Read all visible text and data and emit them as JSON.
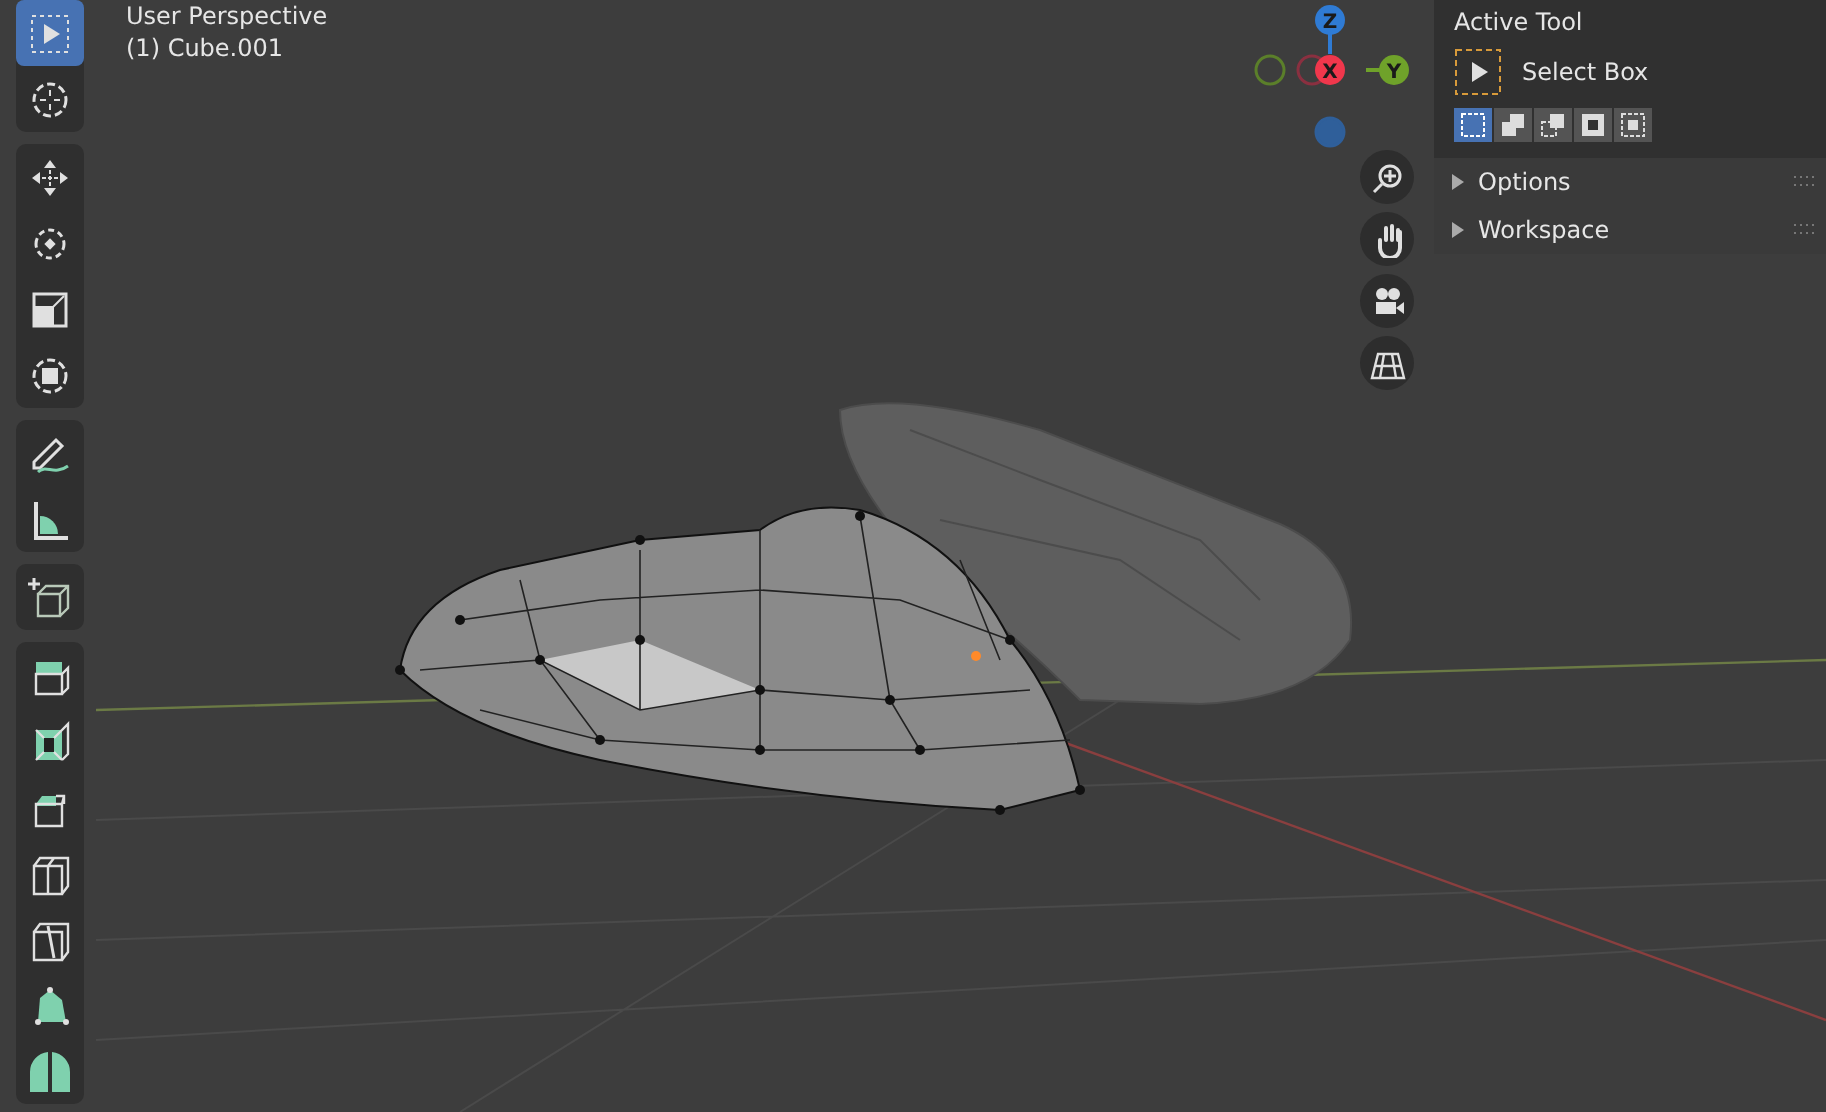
{
  "toolbar": {
    "groups": [
      {
        "tools": [
          {
            "kind": "select",
            "selected": true
          },
          {
            "kind": "cursor",
            "selected": false
          }
        ]
      },
      {
        "tools": [
          {
            "kind": "move",
            "selected": false
          },
          {
            "kind": "rotate",
            "selected": false
          },
          {
            "kind": "scale",
            "selected": false
          },
          {
            "kind": "transform",
            "selected": false
          }
        ]
      },
      {
        "tools": [
          {
            "kind": "annotate",
            "selected": false
          },
          {
            "kind": "measure",
            "selected": false
          }
        ]
      },
      {
        "tools": [
          {
            "kind": "add-cube",
            "selected": false
          }
        ]
      },
      {
        "tools": [
          {
            "kind": "extrude",
            "selected": false
          },
          {
            "kind": "inset",
            "selected": false
          },
          {
            "kind": "bevel",
            "selected": false
          },
          {
            "kind": "loop-cut",
            "selected": false
          },
          {
            "kind": "knife",
            "selected": false
          },
          {
            "kind": "poly-build",
            "selected": false
          },
          {
            "kind": "spin",
            "selected": false
          }
        ]
      }
    ]
  },
  "viewport": {
    "perspective": "User Perspective",
    "object": "(1) Cube.001"
  },
  "gizmo": {
    "axes": [
      {
        "label": "Z",
        "kind": "z"
      },
      {
        "label": "X",
        "kind": "x"
      },
      {
        "label": "Y",
        "kind": "y"
      }
    ]
  },
  "navigation": [
    {
      "kind": "zoom"
    },
    {
      "kind": "pan"
    },
    {
      "kind": "camera"
    },
    {
      "kind": "ortho"
    }
  ],
  "sidebar": {
    "header": "Active Tool",
    "tool": "Select Box",
    "modes": [
      {
        "kind": "new",
        "selected": true
      },
      {
        "kind": "extend",
        "selected": false
      },
      {
        "kind": "subtract",
        "selected": false
      },
      {
        "kind": "difference",
        "selected": false
      },
      {
        "kind": "intersect",
        "selected": false
      }
    ],
    "panels": [
      {
        "label": "Options",
        "expanded": false
      },
      {
        "label": "Workspace",
        "expanded": false
      }
    ]
  }
}
